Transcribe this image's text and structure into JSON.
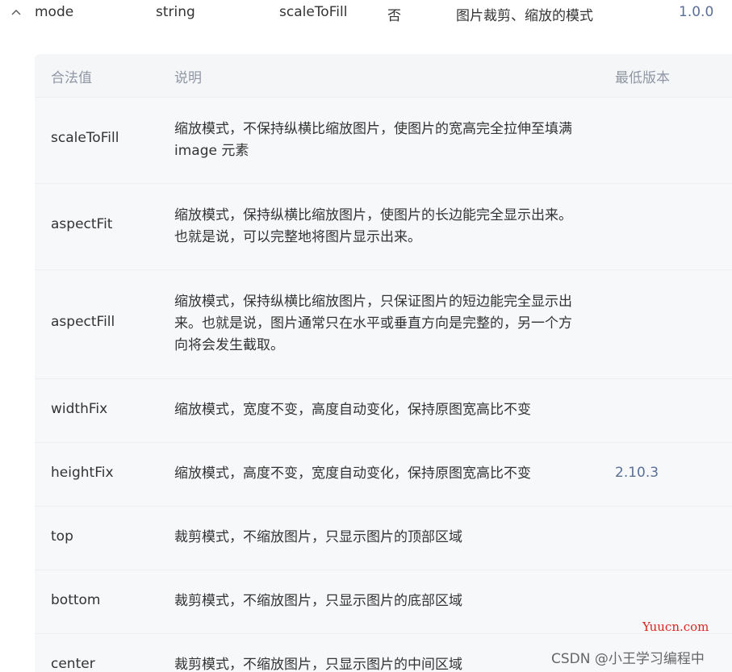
{
  "property": {
    "name": "mode",
    "type": "string",
    "default": "scaleToFill",
    "required": "否",
    "description": "图片裁剪、缩放的模式",
    "version": "1.0.0"
  },
  "values_table": {
    "headers": {
      "value": "合法值",
      "description": "说明",
      "version": "最低版本"
    },
    "rows": [
      {
        "value": "scaleToFill",
        "description": "缩放模式，不保持纵横比缩放图片，使图片的宽高完全拉伸至填满 image 元素",
        "version": ""
      },
      {
        "value": "aspectFit",
        "description": "缩放模式，保持纵横比缩放图片，使图片的长边能完全显示出来。也就是说，可以完整地将图片显示出来。",
        "version": ""
      },
      {
        "value": "aspectFill",
        "description": "缩放模式，保持纵横比缩放图片，只保证图片的短边能完全显示出来。也就是说，图片通常只在水平或垂直方向是完整的，另一个方向将会发生截取。",
        "version": ""
      },
      {
        "value": "widthFix",
        "description": "缩放模式，宽度不变，高度自动变化，保持原图宽高比不变",
        "version": ""
      },
      {
        "value": "heightFix",
        "description": "缩放模式，高度不变，宽度自动变化，保持原图宽高比不变",
        "version": "2.10.3"
      },
      {
        "value": "top",
        "description": "裁剪模式，不缩放图片，只显示图片的顶部区域",
        "version": ""
      },
      {
        "value": "bottom",
        "description": "裁剪模式，不缩放图片，只显示图片的底部区域",
        "version": ""
      },
      {
        "value": "center",
        "description": "裁剪模式，不缩放图片，只显示图片的中间区域",
        "version": ""
      }
    ]
  },
  "watermarks": {
    "site": "Yuucn.com",
    "author": "CSDN @小王学习编程中"
  },
  "icons": {
    "collapse": "chevron-up-icon"
  },
  "colors": {
    "version_link": "#5a6f99",
    "table_bg": "#f7f8fa",
    "header_text": "#8f96a3",
    "watermark_red": "#d9261c"
  }
}
